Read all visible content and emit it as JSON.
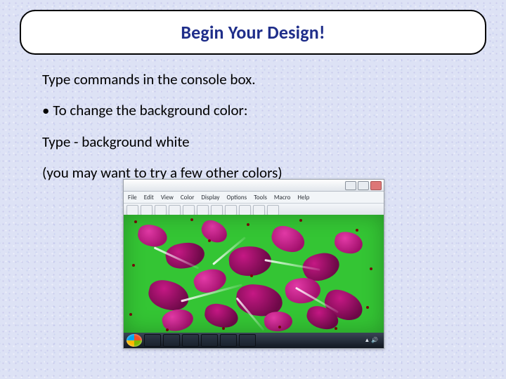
{
  "title": "Begin Your Design!",
  "intro": "Type commands in the console box.",
  "bullet": "• To change the background color:",
  "sub1": "Type -  background white",
  "sub2": "(you may want to try a few other colors)",
  "app": {
    "menu": [
      "File",
      "Edit",
      "View",
      "Color",
      "Display",
      "Options",
      "Tools",
      "Macro",
      "Help"
    ]
  }
}
